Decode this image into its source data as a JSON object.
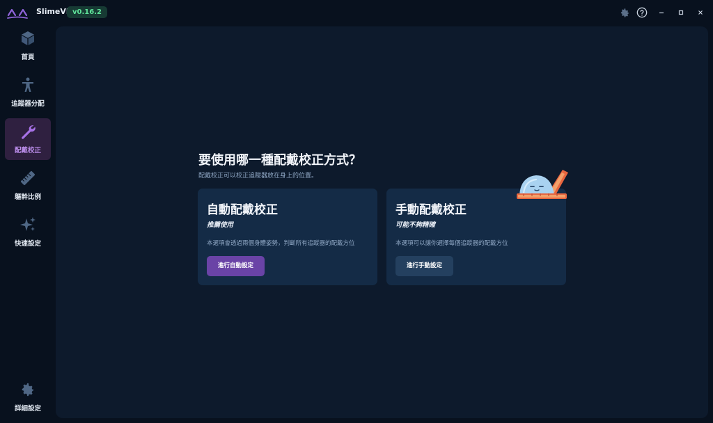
{
  "app": {
    "name": "SlimeVR",
    "version": "v0.16.2"
  },
  "window_controls": {
    "settings_icon": "gear-icon",
    "help_icon": "help-circle-icon",
    "minimize_icon": "minimize-icon",
    "maximize_icon": "maximize-icon",
    "close_icon": "close-icon"
  },
  "sidebar": {
    "items": [
      {
        "label": "首頁",
        "icon": "cube-icon",
        "active": false
      },
      {
        "label": "追蹤器分配",
        "icon": "person-icon",
        "active": false
      },
      {
        "label": "配戴校正",
        "icon": "wrench-icon",
        "active": true
      },
      {
        "label": "軀幹比例",
        "icon": "ruler-icon",
        "active": false
      },
      {
        "label": "快速設定",
        "icon": "sparkles-icon",
        "active": false
      }
    ],
    "settings": {
      "label": "詳細設定",
      "icon": "gear-icon"
    }
  },
  "main": {
    "title": "要使用哪一種配戴校正方式？",
    "subtitle": "配戴校正可以校正追蹤器放在身上的位置。",
    "cards": [
      {
        "title": "自動配戴校正",
        "tag": "推薦使用",
        "description": "本選項會透過兩個身體姿勢，判斷所有追蹤器的配戴方位",
        "button_label": "進行自動設定"
      },
      {
        "title": "手動配戴校正",
        "tag": "可能不夠精確",
        "description": "本選項可以讓你選擇每個追蹤器的配戴方位",
        "button_label": "進行手動設定"
      }
    ]
  },
  "colors": {
    "background": "#08111e",
    "panel": "#0d1a2c",
    "card": "#142b46",
    "accent": "#6a43a6",
    "active_nav": "#2f2040",
    "version_text": "#5fe39a"
  }
}
